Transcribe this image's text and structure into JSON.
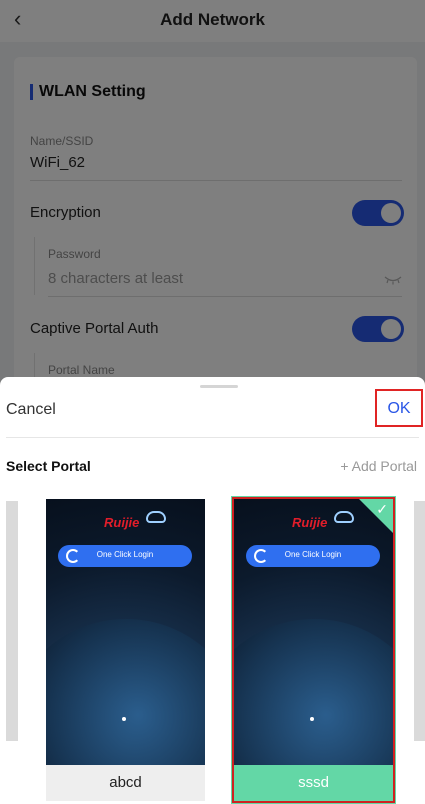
{
  "header": {
    "back_icon": "chevron-left-icon",
    "back_glyph": "‹",
    "title": "Add Network"
  },
  "form": {
    "section_title": "WLAN Setting",
    "ssid_label": "Name/SSID",
    "ssid_value": "WiFi_62",
    "encryption_label": "Encryption",
    "encryption_on": true,
    "password_label": "Password",
    "password_placeholder": "8 characters at least",
    "captive_label": "Captive Portal Auth",
    "captive_on": true,
    "portal_name_label": "Portal Name"
  },
  "sheet": {
    "cancel_label": "Cancel",
    "ok_label": "OK",
    "select_portal_label": "Select Portal",
    "add_portal_label": "+ Add Portal",
    "portals": [
      {
        "name": "abcd",
        "logo": "Ruijie",
        "button": "One Click Login",
        "selected": false
      },
      {
        "name": "sssd",
        "logo": "Ruijie",
        "button": "One Click Login",
        "selected": true
      }
    ],
    "check_glyph": "✓"
  },
  "colors": {
    "accent": "#2a56e6",
    "selected": "#63d7a6",
    "highlight": "#e02424"
  }
}
